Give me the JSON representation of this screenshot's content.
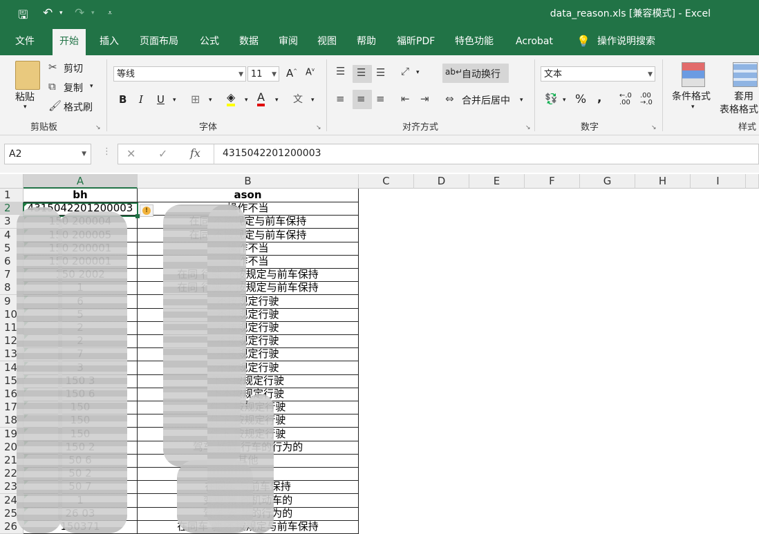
{
  "window": {
    "title": "data_reason.xls  [兼容模式]  -  Excel"
  },
  "tabs": [
    "文件",
    "开始",
    "插入",
    "页面布局",
    "公式",
    "数据",
    "审阅",
    "视图",
    "帮助",
    "福昕PDF",
    "特色功能",
    "Acrobat",
    "操作说明搜索"
  ],
  "clipboard": {
    "paste": "粘贴",
    "cut": "剪切",
    "copy": "复制",
    "format_painter": "格式刷",
    "group": "剪贴板"
  },
  "font": {
    "name": "等线",
    "size": "11",
    "group": "字体"
  },
  "alignment": {
    "wrap": "自动换行",
    "merge": "合并后居中",
    "group": "对齐方式"
  },
  "number": {
    "format": "文本",
    "group": "数字"
  },
  "styles": {
    "cond": "条件格式",
    "table1": "套用",
    "table2": "表格格式",
    "group": "样式"
  },
  "formula_bar": {
    "name_box": "A2",
    "fx": "fx",
    "value": "4315042201200003"
  },
  "columns": [
    "A",
    "B",
    "C",
    "D",
    "E",
    "F",
    "G",
    "H",
    "I"
  ],
  "rows": [
    {
      "num": "1",
      "a": "bh",
      "b": "ason"
    },
    {
      "num": "2",
      "a": "4315042201200003",
      "b": "操作不当"
    },
    {
      "num": "3",
      "a": "150 200004",
      "b": "在同 不按规定与前车保持"
    },
    {
      "num": "4",
      "a": "150 200005",
      "b": "在同 不按规定与前车保持"
    },
    {
      "num": "5",
      "a": "150 200001",
      "b": "操作不当"
    },
    {
      "num": "6",
      "a": "150 200001",
      "b": "操作不当"
    },
    {
      "num": "7",
      "a": "150 2002",
      "b": "在同 行驶 不按规定与前车保持"
    },
    {
      "num": "8",
      "a": "1",
      "b": "在同 行驶 不按规定与前车保持"
    },
    {
      "num": "9",
      "a": "6",
      "b": "不按规定行驶"
    },
    {
      "num": "10",
      "a": "5",
      "b": "不按规定行驶"
    },
    {
      "num": "11",
      "a": "2",
      "b": "不按规定行驶"
    },
    {
      "num": "12",
      "a": "2",
      "b": "不按规定行驶"
    },
    {
      "num": "13",
      "a": "7",
      "b": "不按规定行驶"
    },
    {
      "num": "14",
      "a": "3",
      "b": "不按规定行驶"
    },
    {
      "num": "15",
      "a": "150 3",
      "b": "下不按规定行驶"
    },
    {
      "num": "16",
      "a": "150 6",
      "b": "下不按规定行驶"
    },
    {
      "num": "17",
      "a": "150",
      "b": "件下 按规定行驶"
    },
    {
      "num": "18",
      "a": "150",
      "b": "件下 按规定行驶"
    },
    {
      "num": "19",
      "a": "150",
      "b": "件下 按规定行驶"
    },
    {
      "num": "20",
      "a": "150 2",
      "b": "驾车 妨碍 行车的行为的"
    },
    {
      "num": "21",
      "a": "50 6",
      "b": "其他"
    },
    {
      "num": "22",
      "a": "50 2",
      "b": ""
    },
    {
      "num": "23",
      "a": "50 7",
      "b": "在同车 与前车保持"
    },
    {
      "num": "24",
      "a": "1",
      "b": "变更 常 的机动车的"
    },
    {
      "num": "25",
      "a": "26 03",
      "b": "驾车 安 车的行为的"
    },
    {
      "num": "26",
      "a": "150371",
      "b": "在同车 驶 不按规定与前车保持"
    }
  ]
}
